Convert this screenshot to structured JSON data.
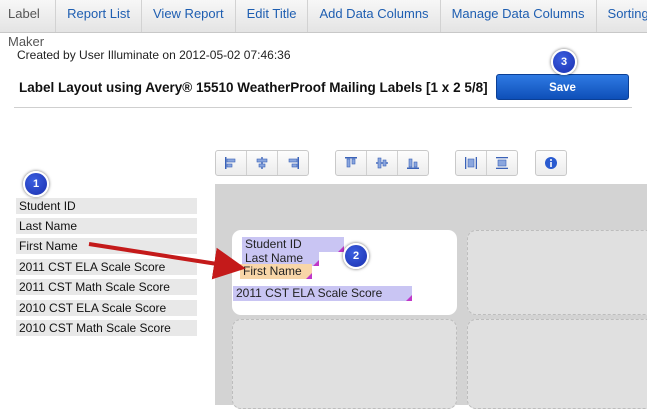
{
  "nav": {
    "brand": "Label Maker",
    "items": [
      "Report List",
      "View Report",
      "Edit Title",
      "Add Data Columns",
      "Manage Data Columns",
      "Sorting"
    ]
  },
  "meta": {
    "created": "Created by User Illuminate on 2012-05-02 07:46:36"
  },
  "layout": {
    "title": "Label Layout using Avery® 15510 WeatherProof Mailing Labels [1 x 2 5/8]",
    "save_label": "Save"
  },
  "badges": [
    "1",
    "2",
    "3"
  ],
  "toolbar": {
    "icons": [
      "align-left-icon",
      "align-center-icon",
      "align-right-icon",
      "align-top-icon",
      "align-middle-icon",
      "align-bottom-icon",
      "distribute-horizontal-icon",
      "distribute-vertical-icon",
      "info-icon"
    ]
  },
  "fields": [
    "Student ID",
    "Last Name",
    "First Name",
    "2011 CST ELA Scale Score",
    "2011 CST Math Scale Score",
    "2010 CST ELA Scale Score",
    "2010 CST Math Scale Score"
  ],
  "label_chips": [
    "Student ID",
    "Last Name",
    "First Name",
    "2011 CST ELA Scale Score"
  ],
  "colors": {
    "nav_link": "#1e5eb1",
    "save_button": "#1a5fd0",
    "badge": "#2a44c8",
    "chip_blue": "#c9c5f3",
    "chip_orange": "#f8d6a8",
    "arrow": "#c41a1a"
  }
}
